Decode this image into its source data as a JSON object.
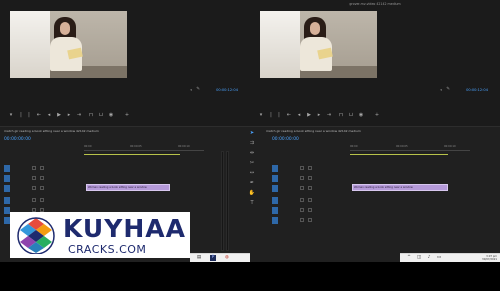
{
  "left_panel": {
    "program_title": "",
    "playhead_time": "00:00:12:04",
    "sequence_tab": "match gir reading a book sitting near a window 42142 medium",
    "sequence_time": "00:00:00:00",
    "clip_label": "Woman reading a book sitting near a window",
    "ruler_ticks": [
      "00:00",
      "00:00:05",
      "00:00:10"
    ]
  },
  "right_panel": {
    "program_title": "grover-mv-video 42142 medium",
    "playhead_time": "00:00:12:04",
    "sequence_tab": "match gir reading a book sitting near a window 42142 medium",
    "sequence_time": "00:00:00:00",
    "clip_label": "Woman reading a book sitting near a window",
    "ruler_ticks": [
      "00:00",
      "00:00:05",
      "00:00:10"
    ]
  },
  "taskbar": {
    "time": "3:07 pm",
    "date": "30/07/2021"
  },
  "overlay": {
    "brand_name": "KUYHAA",
    "brand_sub": "CRACKS.COM"
  },
  "colors": {
    "timecode": "#4aa3ff",
    "clip": "#b59ad9",
    "track_patch": "#2e68a8",
    "brand": "#1e2a6e",
    "work_area": "#b8c34a"
  }
}
